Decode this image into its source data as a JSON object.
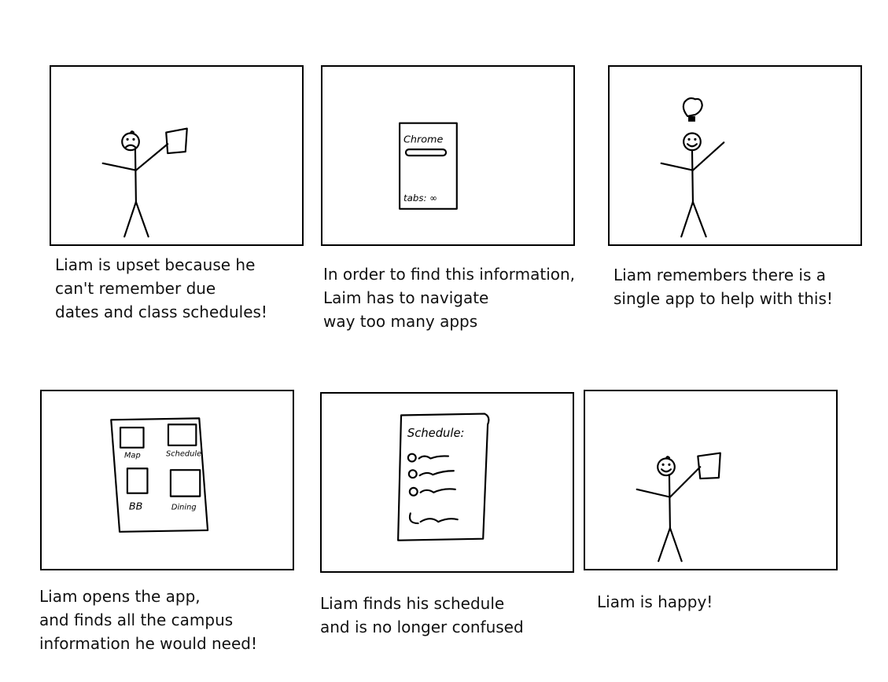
{
  "storyboard": {
    "panels": [
      {
        "caption": "Liam is upset because he\ncan't remember due\ndates and class schedules!"
      },
      {
        "caption": "In order to find this information,\nLaim has to navigate\nway too many apps",
        "phone": {
          "app_label": "Chrome",
          "tabs_label": "tabs: ∞"
        }
      },
      {
        "caption": "Liam remembers there is a\nsingle app to help with this!"
      },
      {
        "caption": "Liam opens the app,\nand finds all the campus\ninformation he would need!",
        "app_tiles": [
          "Map",
          "Schedule",
          "BB",
          "Dining"
        ]
      },
      {
        "caption": "Liam finds his schedule\nand is no longer confused",
        "schedule": {
          "title": "Schedule:"
        }
      },
      {
        "caption": "Liam is happy!"
      }
    ]
  }
}
